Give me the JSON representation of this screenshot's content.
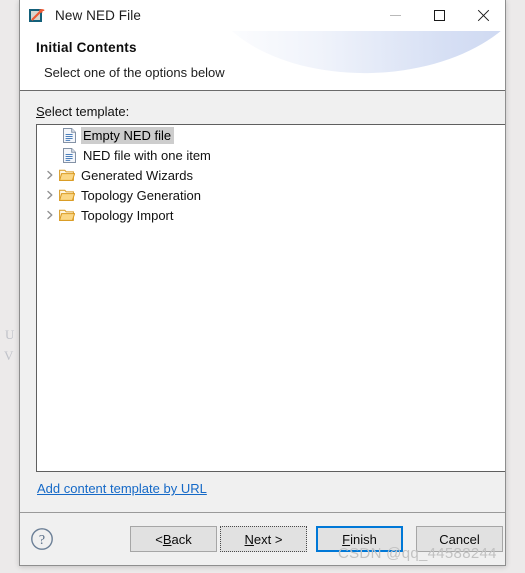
{
  "window": {
    "title": "New NED File",
    "icon": "ned-file-icon",
    "controls": {
      "minimize": "minimize-icon",
      "maximize": "maximize-icon",
      "close": "close-icon"
    }
  },
  "header": {
    "title": "Initial Contents",
    "subtitle": "Select one of the options below"
  },
  "body": {
    "tree_label": "Select template:",
    "tree_label_mnemonic": "S",
    "tree_label_rest": "elect template:",
    "tree": [
      {
        "label": "Empty NED file",
        "icon": "file-icon",
        "indent": 18,
        "expandable": false,
        "selected": true
      },
      {
        "label": "NED file with one item",
        "icon": "file-icon",
        "indent": 18,
        "expandable": false,
        "selected": false
      },
      {
        "label": "Generated Wizards",
        "icon": "folder-icon",
        "indent": 0,
        "expandable": true,
        "selected": false
      },
      {
        "label": "Topology Generation",
        "icon": "folder-icon",
        "indent": 0,
        "expandable": true,
        "selected": false
      },
      {
        "label": "Topology Import",
        "icon": "folder-icon",
        "indent": 0,
        "expandable": true,
        "selected": false
      }
    ],
    "url_link": "Add content template by URL"
  },
  "buttons": {
    "help": "help-icon",
    "back": {
      "prefix": "< ",
      "mnemonic": "B",
      "suffix": "ack",
      "full": "< Back"
    },
    "next": {
      "prefix": "",
      "mnemonic": "N",
      "suffix": "ext >",
      "full": "Next >"
    },
    "finish": {
      "prefix": "",
      "mnemonic": "F",
      "suffix": "inish",
      "full": "Finish"
    },
    "cancel": {
      "prefix": "",
      "mnemonic": "",
      "suffix": "Cancel",
      "full": "Cancel"
    }
  },
  "watermark": "CSDN @qq_44588244",
  "background_ghost": {
    "line1": "U",
    "line2": "V"
  },
  "colors": {
    "accent": "#0078d7",
    "link": "#1569c7",
    "selection": "#cdcdcd",
    "dialog_bg": "#f0f0f0",
    "panel_bg": "#ffffff",
    "folder": "#f5b84c"
  }
}
